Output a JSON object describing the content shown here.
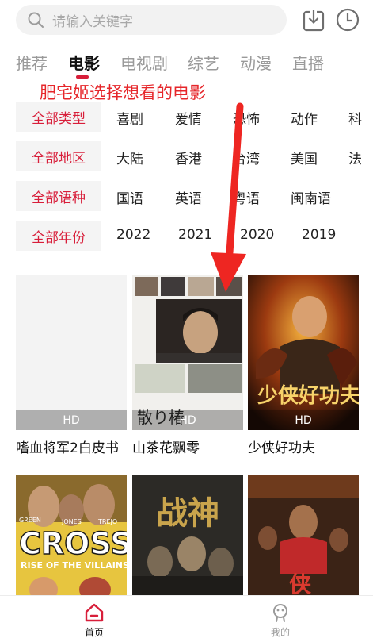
{
  "search": {
    "placeholder": "请输入关键字"
  },
  "tabs": [
    {
      "label": "推荐"
    },
    {
      "label": "电影"
    },
    {
      "label": "电视剧"
    },
    {
      "label": "综艺"
    },
    {
      "label": "动漫"
    },
    {
      "label": "直播"
    }
  ],
  "annotation": "肥宅姬选择想看的电影",
  "filters": [
    {
      "label": "全部类型",
      "options": [
        "喜剧",
        "爱情",
        "恐怖",
        "动作",
        "科"
      ]
    },
    {
      "label": "全部地区",
      "options": [
        "大陆",
        "香港",
        "台湾",
        "美国",
        "法"
      ]
    },
    {
      "label": "全部语种",
      "options": [
        "国语",
        "英语",
        "粤语",
        "闽南语"
      ]
    },
    {
      "label": "全部年份",
      "options": [
        "2022",
        "2021",
        "2020",
        "2019"
      ]
    }
  ],
  "movies": [
    {
      "title": "嗜血将军2白皮书",
      "badge": "HD"
    },
    {
      "title": "山茶花飘零",
      "badge": "HD",
      "poster_text": "散り椿"
    },
    {
      "title": "少侠好功夫",
      "badge": "HD",
      "poster_text": "少侠好功夫"
    },
    {
      "title": "",
      "badge": "",
      "poster_text": "CROSS",
      "poster_sub": "RISE OF THE VILLAINS",
      "poster_names": [
        "GREEN",
        "JONES",
        "TREJO"
      ]
    },
    {
      "title": "",
      "badge": "",
      "poster_text": "战神"
    },
    {
      "title": "",
      "badge": "",
      "poster_text": "侠"
    }
  ],
  "bottom_nav": [
    {
      "label": "首页",
      "active": true
    },
    {
      "label": "我的",
      "active": false
    }
  ],
  "colors": {
    "accent": "#d81e3a",
    "annotation": "#e6262a",
    "chip_bg": "#f4f4f4",
    "search_bg": "#f2f2f2"
  }
}
